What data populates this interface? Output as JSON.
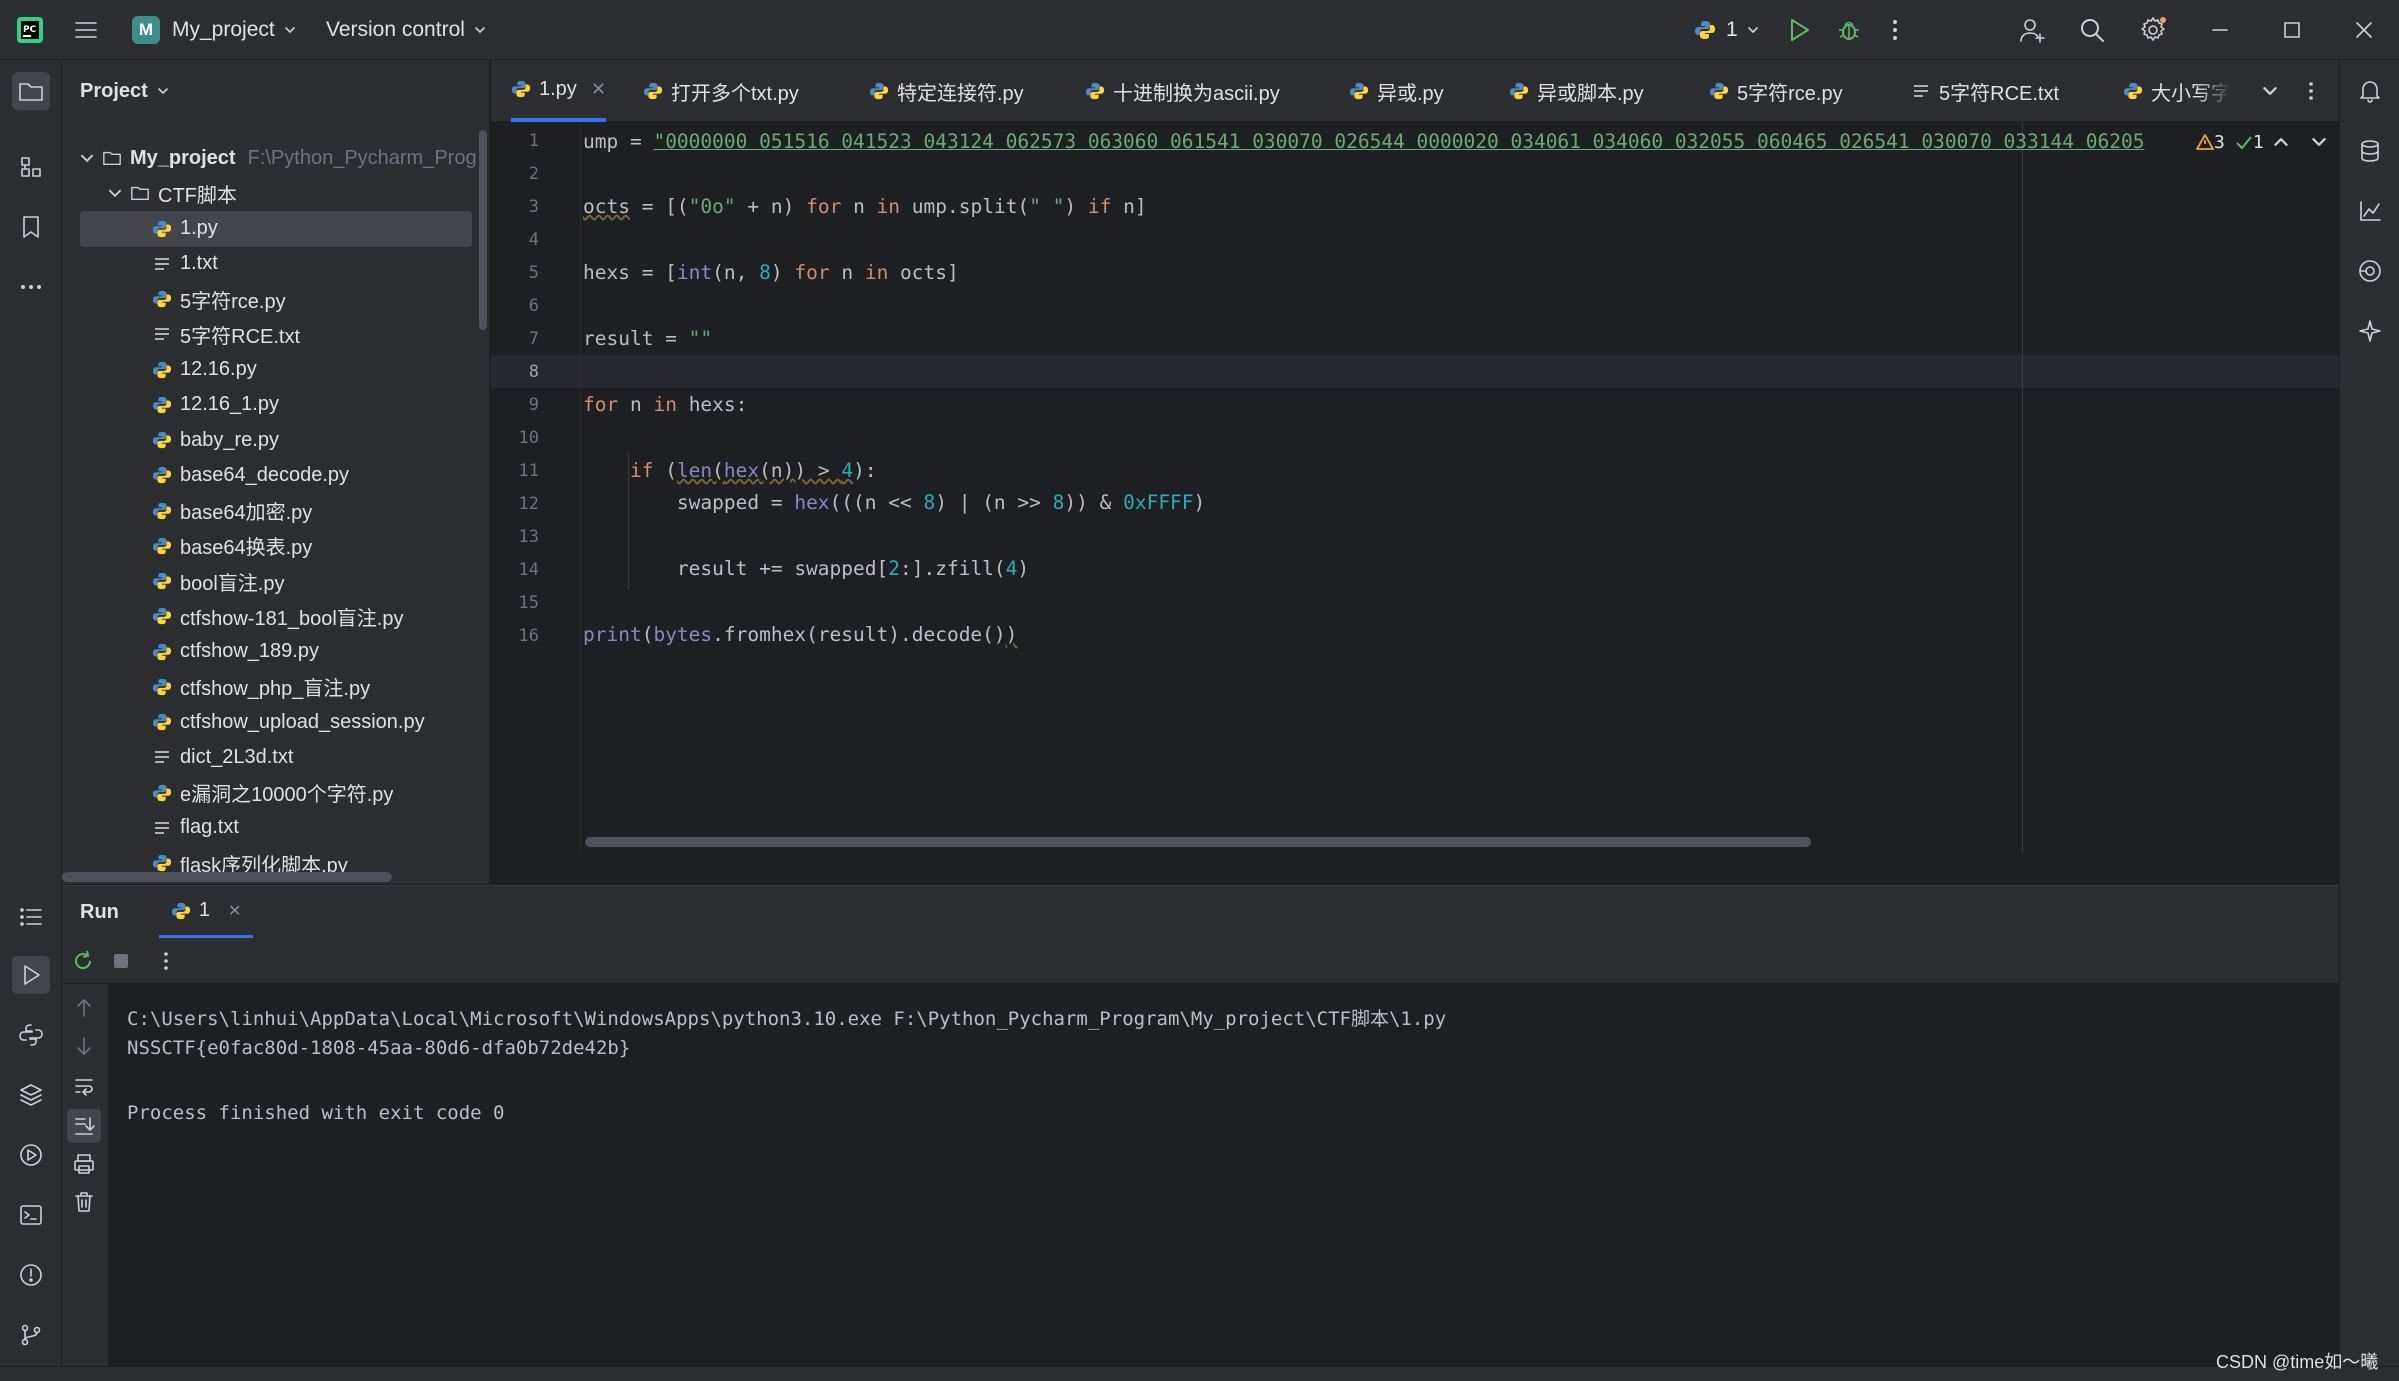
{
  "titlebar": {
    "project_badge": "M",
    "project_name": "My_project",
    "vcs_label": "Version control",
    "run_config": "1"
  },
  "project_panel": {
    "title": "Project",
    "tree": [
      {
        "label": "My_project",
        "tip": "F:\\Python_Pycharm_Prog",
        "kind": "folder",
        "depth": 0
      },
      {
        "label": "CTF脚本",
        "tip": "",
        "kind": "folder",
        "depth": 1
      },
      {
        "label": "1.py",
        "kind": "py",
        "depth": 2,
        "selected": true
      },
      {
        "label": "1.txt",
        "kind": "txt",
        "depth": 2
      },
      {
        "label": "5字符rce.py",
        "kind": "py",
        "depth": 2
      },
      {
        "label": "5字符RCE.txt",
        "kind": "txt",
        "depth": 2
      },
      {
        "label": "12.16.py",
        "kind": "py",
        "depth": 2
      },
      {
        "label": "12.16_1.py",
        "kind": "py",
        "depth": 2
      },
      {
        "label": "baby_re.py",
        "kind": "py",
        "depth": 2
      },
      {
        "label": "base64_decode.py",
        "kind": "py",
        "depth": 2
      },
      {
        "label": "base64加密.py",
        "kind": "py",
        "depth": 2
      },
      {
        "label": "base64换表.py",
        "kind": "py",
        "depth": 2
      },
      {
        "label": "bool盲注.py",
        "kind": "py",
        "depth": 2
      },
      {
        "label": "ctfshow-181_bool盲注.py",
        "kind": "py",
        "depth": 2
      },
      {
        "label": "ctfshow_189.py",
        "kind": "py",
        "depth": 2
      },
      {
        "label": "ctfshow_php_盲注.py",
        "kind": "py",
        "depth": 2
      },
      {
        "label": "ctfshow_upload_session.py",
        "kind": "py",
        "depth": 2
      },
      {
        "label": "dict_2L3d.txt",
        "kind": "txt",
        "depth": 2
      },
      {
        "label": "e漏洞之10000个字符.py",
        "kind": "py",
        "depth": 2
      },
      {
        "label": "flag.txt",
        "kind": "txt",
        "depth": 2
      },
      {
        "label": "flask序列化脚本.py",
        "kind": "py",
        "depth": 2
      }
    ]
  },
  "tabs": [
    {
      "label": "1.py",
      "kind": "py",
      "active": true
    },
    {
      "label": "打开多个txt.py",
      "kind": "py"
    },
    {
      "label": "特定连接符.py",
      "kind": "py"
    },
    {
      "label": "十进制换为ascii.py",
      "kind": "py"
    },
    {
      "label": "异或.py",
      "kind": "py"
    },
    {
      "label": "异或脚本.py",
      "kind": "py"
    },
    {
      "label": "5字符rce.py",
      "kind": "py"
    },
    {
      "label": "5字符RCE.txt",
      "kind": "txt"
    },
    {
      "label": "大小写字",
      "kind": "py"
    }
  ],
  "editor": {
    "line_numbers": [
      "1",
      "2",
      "3",
      "4",
      "5",
      "6",
      "7",
      "8",
      "9",
      "10",
      "11",
      "12",
      "13",
      "14",
      "15",
      "16"
    ],
    "current_line": 8,
    "warnings_count": "3",
    "ok_count": "1",
    "line1_prefix": "ump = ",
    "line1_string": "\"0000000 051516 041523 043124 062573 063060 061541 030070 026544 0000020 034061 034060 032055 060465 026541 030070 033144 06205",
    "line3_a": "octs",
    "line3_b": " = [(",
    "line3_c": "\"0o\"",
    "line3_d": " + n) ",
    "line3_e": "for",
    "line3_f": " n ",
    "line3_g": "in",
    "line3_h": " ump.split(",
    "line3_i": "\" \"",
    "line3_j": ") ",
    "line3_k": "if",
    "line3_l": " n]",
    "line5_a": "hexs = [",
    "line5_b": "int",
    "line5_c": "(n, ",
    "line5_d": "8",
    "line5_e": ") ",
    "line5_f": "for",
    "line5_g": " n ",
    "line5_h": "in",
    "line5_i": " octs]",
    "line7_a": "result = ",
    "line7_b": "\"\"",
    "line9_a": "for",
    "line9_b": " n ",
    "line9_c": "in",
    "line9_d": " hexs:",
    "line11_a": "    ",
    "line11_b": "if",
    "line11_c": " (",
    "line11_d": "len",
    "line11_e": "(",
    "line11_f": "hex",
    "line11_g": "(n)) > ",
    "line11_h": "4",
    "line11_i": "):",
    "line12_a": "        swapped = ",
    "line12_b": "hex",
    "line12_c": "(((n << ",
    "line12_d": "8",
    "line12_e": ") | (n >> ",
    "line12_f": "8",
    "line12_g": ")) & ",
    "line12_h": "0xFFFF",
    "line12_i": ")",
    "line14_a": "        result += swapped[",
    "line14_b": "2",
    "line14_c": ":].zfill(",
    "line14_d": "4",
    "line14_e": ")",
    "line16_a": "print",
    "line16_b": "(",
    "line16_c": "bytes",
    "line16_d": ".fromhex(result).decode()",
    "line16_e": ")"
  },
  "run": {
    "title": "Run",
    "tab_label": "1",
    "console": [
      "C:\\Users\\linhui\\AppData\\Local\\Microsoft\\WindowsApps\\python3.10.exe F:\\Python_Pycharm_Program\\My_project\\CTF脚本\\1.py",
      "NSSCTF{e0fac80d-1808-45aa-80d6-dfa0b72de42b}",
      "",
      "Process finished with exit code 0"
    ]
  },
  "watermark": "CSDN @time如～曦",
  "colors": {
    "accent": "#3574f0",
    "python_blue": "#4b8bbe",
    "python_yellow": "#ffd43b",
    "run_green": "#5fb865"
  }
}
